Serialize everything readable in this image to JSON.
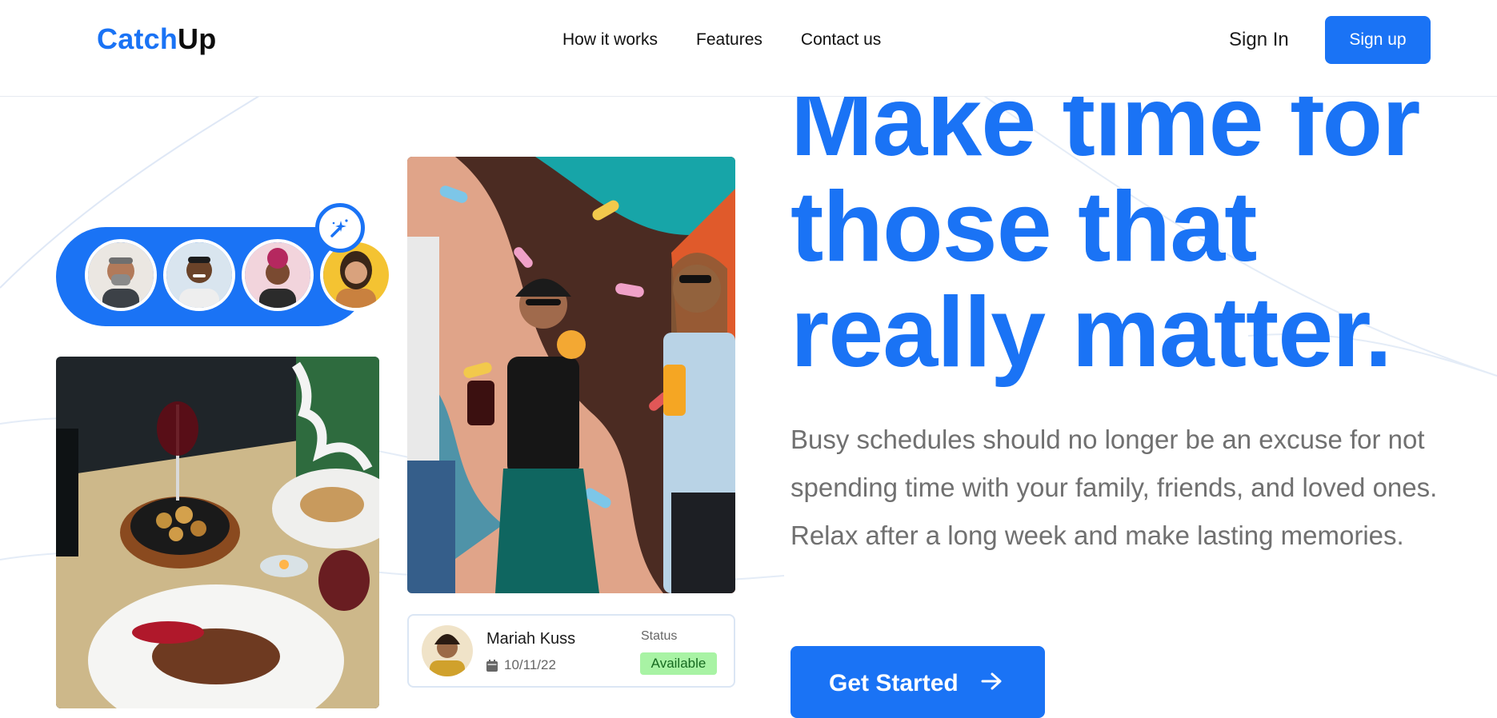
{
  "brand": {
    "part1": "Catch",
    "part2": "Up"
  },
  "nav": {
    "links": [
      "How it works",
      "Features",
      "Contact us"
    ],
    "signin": "Sign In",
    "signup": "Sign up"
  },
  "hero": {
    "headline": [
      "Make time for",
      "those that",
      "really matter."
    ],
    "description": "Busy schedules should no longer be an excuse for not spending time with your family, friends, and loved ones. Relax after a long week and make lasting memories.",
    "cta_label": "Get Started"
  },
  "profile_card": {
    "name": "Mariah Kuss",
    "date": "10/11/22",
    "status_label": "Status",
    "status_value": "Available"
  },
  "icons": {
    "sparkle": "sparkle-icon",
    "calendar": "calendar-icon",
    "arrow": "arrow-right-icon"
  },
  "colors": {
    "accent": "#1a73f5",
    "available_bg": "#a8f3a4",
    "available_text": "#176a20"
  }
}
